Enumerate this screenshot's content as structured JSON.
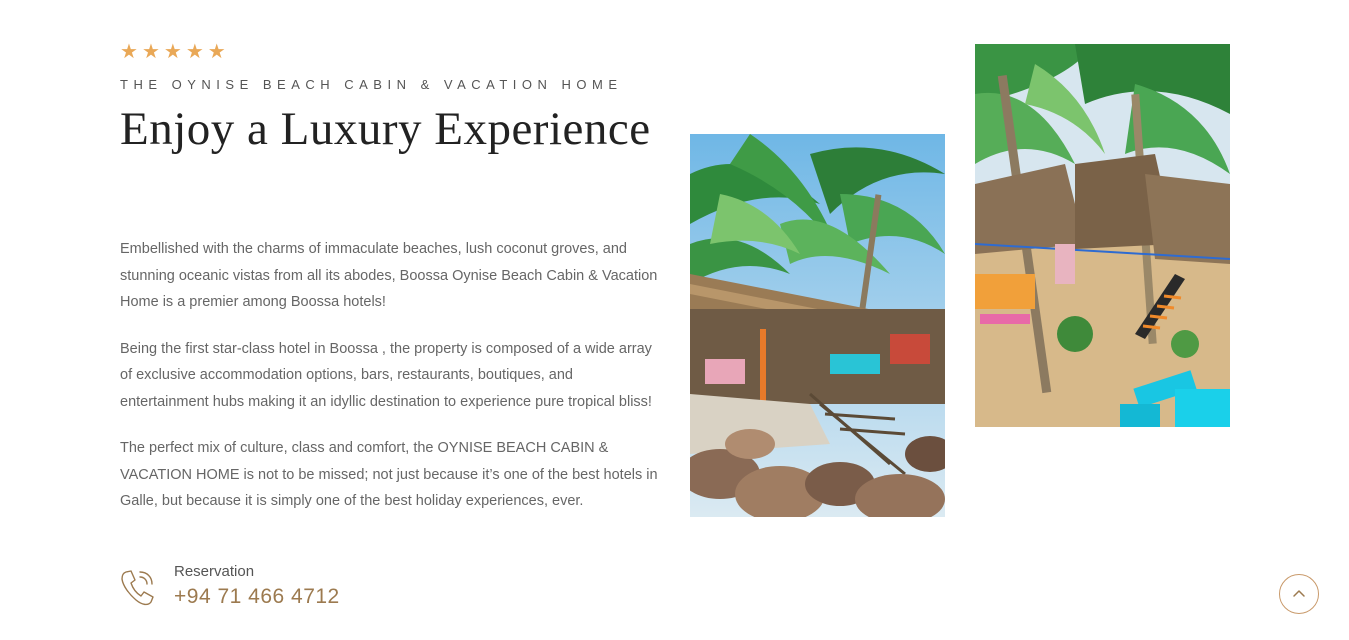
{
  "rating": {
    "stars": 5,
    "star_glyph": "★",
    "color": "#e9a857"
  },
  "subtitle": "THE OYNISE BEACH CABIN & VACATION HOME",
  "title": "Enjoy a Luxury Experience",
  "paragraphs": [
    "Embellished with the charms of immaculate beaches, lush coconut groves, and stunning oceanic vistas from all its abodes, Boossa Oynise Beach Cabin & Vacation Home is a premier among Boossa hotels!",
    "Being the first star-class hotel in Boossa , the property is composed of a wide array of exclusive accommodation options, bars, restaurants, boutiques, and entertainment hubs making it an idyllic destination to experience pure tropical bliss!",
    "The perfect mix of culture, class and comfort, the OYNISE BEACH CABIN & VACATION HOME is not to be missed; not just because it’s one of the best hotels in Galle, but because it is simply one of the best holiday experiences, ever."
  ],
  "reservation": {
    "label": "Reservation",
    "phone": "+94 71 466 4712",
    "icon": "phone-icon"
  },
  "photos": [
    {
      "name": "beach-cabin-deck-photo",
      "subject": "thatched cabin deck on rocks under palm trees"
    },
    {
      "name": "beach-cabins-garden-photo",
      "subject": "thatched cabins with stairs and turquoise benches on sand"
    }
  ],
  "scroll_top": {
    "icon": "chevron-up-icon"
  },
  "colors": {
    "accent": "#9c7a4f",
    "star": "#e9a857",
    "heading": "#222222",
    "body": "#666666"
  }
}
